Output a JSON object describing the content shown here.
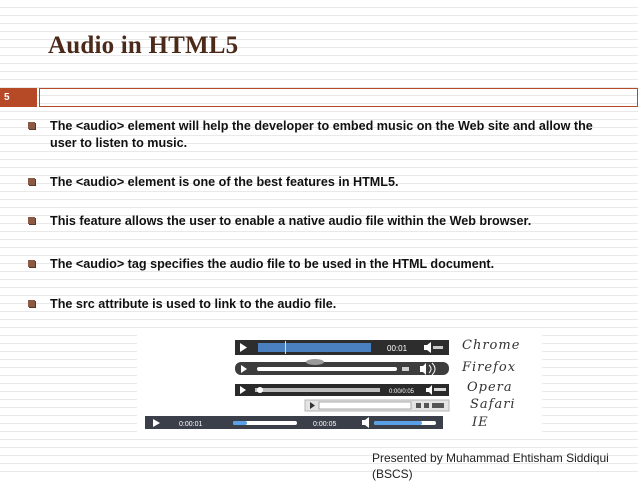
{
  "slide": {
    "title": "Audio in HTML5",
    "number": "5"
  },
  "bullets": [
    "The <audio> element will help the developer to embed music on the Web site and allow the user to listen to music.",
    " The <audio> element is one of the best features in HTML5.",
    "This feature allows the user to enable a native audio file within the Web browser.",
    " The <audio> tag specifies the audio file to be used in the HTML document.",
    "The src attribute is used to link to the audio file."
  ],
  "players": [
    {
      "browser": "Chrome",
      "time": "00:01"
    },
    {
      "browser": "Firefox",
      "time": ""
    },
    {
      "browser": "Opera",
      "time": "0:00/0:05"
    },
    {
      "browser": "Safari",
      "time": ""
    },
    {
      "browser": "IE",
      "time_elapsed": "0:00:01",
      "time_total": "0:00:05"
    }
  ],
  "footer": {
    "line1": "Presented by Muhammad Ehtisham Siddiqui",
    "line2": "(BSCS)"
  },
  "colors": {
    "accent": "#b64926",
    "title": "#4b2a1a"
  }
}
